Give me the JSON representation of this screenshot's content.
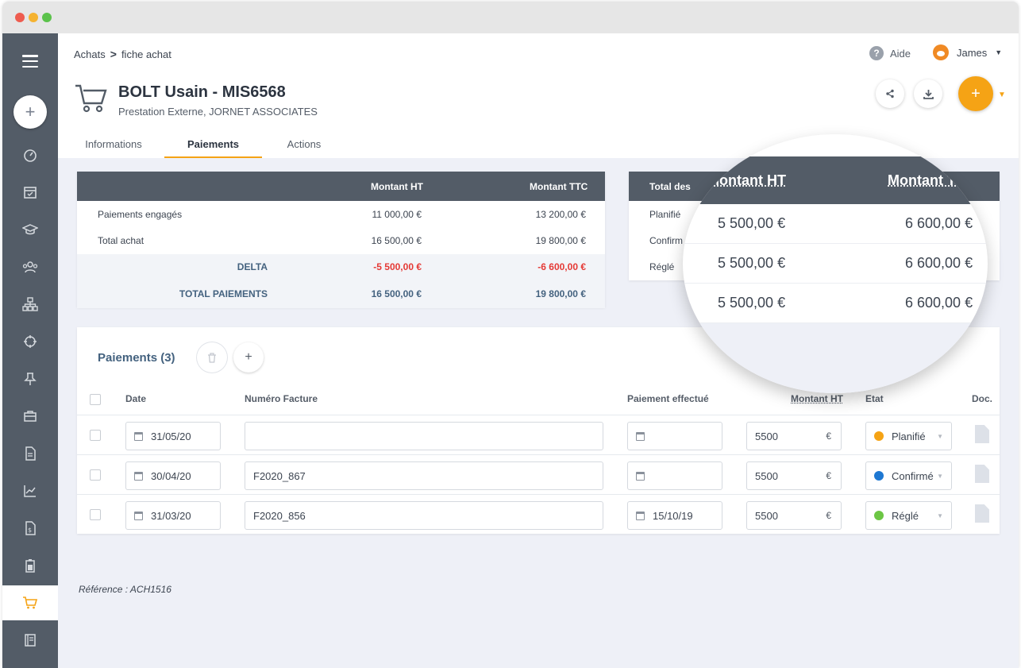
{
  "breadcrumb": {
    "parent": "Achats",
    "separator": ">",
    "current": "fiche achat"
  },
  "header": {
    "help_label": "Aide",
    "user_name": "James",
    "title": "BOLT Usain - MIS6568",
    "subtitle": "Prestation Externe, JORNET ASSOCIATES",
    "fab_label": "+"
  },
  "tabs": [
    {
      "label": "Informations"
    },
    {
      "label": "Paiements"
    },
    {
      "label": "Actions"
    }
  ],
  "summary": {
    "headers": {
      "ht": "Montant HT",
      "ttc": "Montant TTC"
    },
    "rows": [
      {
        "label": "Paiements engagés",
        "ht": "11 000,00 €",
        "ttc": "13 200,00 €"
      },
      {
        "label": "Total achat",
        "ht": "16 500,00 €",
        "ttc": "19 800,00 €"
      },
      {
        "label": "DELTA",
        "ht": "-5 500,00 €",
        "ttc": "-6 600,00 €"
      },
      {
        "label": "TOTAL PAIEMENTS",
        "ht": "16 500,00 €",
        "ttc": "19 800,00 €"
      }
    ]
  },
  "status_totals": {
    "header": "Total des",
    "rows": [
      {
        "label": "Planifié"
      },
      {
        "label": "Confirm"
      },
      {
        "label": "Réglé"
      }
    ]
  },
  "magnifier": {
    "header_ht": "Montant HT",
    "header_ttc": "Montant TTC",
    "rows": [
      {
        "ht": "5 500,00 €",
        "ttc": "6 600,00 €"
      },
      {
        "ht": "5 500,00 €",
        "ttc": "6 600,00 €"
      },
      {
        "ht": "5 500,00 €",
        "ttc": "6 600,00 €"
      }
    ]
  },
  "payments": {
    "title": "Paiements (3)",
    "columns": {
      "date": "Date",
      "invoice": "Numéro Facture",
      "paid": "Paiement effectué",
      "amount": "Montant HT",
      "status": "Etat",
      "doc": "Doc."
    },
    "currency": "€",
    "rows": [
      {
        "date": "31/05/20",
        "invoice": "",
        "paid": "",
        "amount": "5500",
        "status": "Planifié",
        "status_color": "#f5a315"
      },
      {
        "date": "30/04/20",
        "invoice": "F2020_867",
        "paid": "",
        "amount": "5500",
        "status": "Confirmé",
        "status_color": "#1e78d2"
      },
      {
        "date": "31/03/20",
        "invoice": "F2020_856",
        "paid": "15/10/19",
        "amount": "5500",
        "status": "Réglé",
        "status_color": "#6cc644"
      }
    ]
  },
  "reference": "Référence : ACH1516",
  "colors": {
    "accent": "#f5a315",
    "sidebar": "#535c67",
    "negative": "#e53935"
  }
}
